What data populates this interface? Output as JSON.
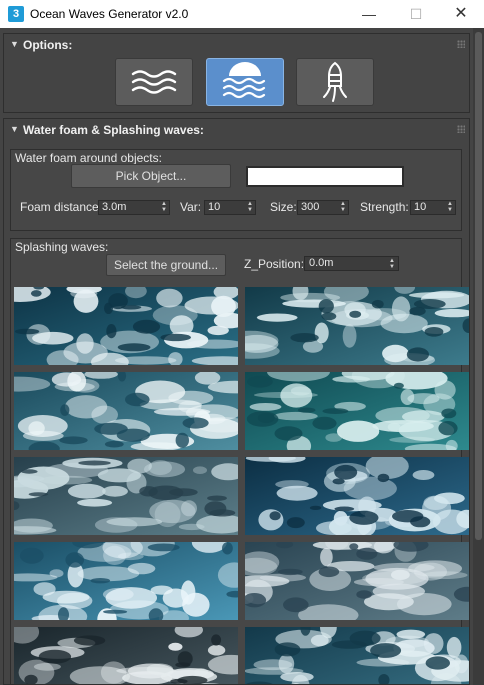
{
  "window": {
    "title": "Ocean Waves Generator v2.0",
    "app_icon": "3",
    "minimize_glyph": "—",
    "maximize_glyph": "☐",
    "close_glyph": "✕"
  },
  "options": {
    "title": "Options:",
    "buttons": [
      {
        "icon": "waves-icon",
        "active": false
      },
      {
        "icon": "sea-sunset-icon",
        "active": true
      },
      {
        "icon": "buoy-icon",
        "active": false
      }
    ]
  },
  "foam_section": {
    "title": "Water foam & Splashing waves:",
    "foam_group": {
      "title": "Water foam around objects:",
      "pick_object_label": "Pick Object...",
      "picked_object_value": "",
      "fields": [
        {
          "label": "Foam distance:",
          "value": "3.0m"
        },
        {
          "label": "Var:",
          "value": "10"
        },
        {
          "label": "Size:",
          "value": "300"
        },
        {
          "label": "Strength:",
          "value": "10"
        }
      ]
    },
    "splash_group": {
      "title": "Splashing waves:",
      "select_ground_label": "Select the ground...",
      "z_position_label": "Z_Position:",
      "z_position_value": "0.0m"
    },
    "thumbnails": [
      {
        "name": "thumbnail-1"
      },
      {
        "name": "thumbnail-2"
      },
      {
        "name": "thumbnail-3"
      },
      {
        "name": "thumbnail-4"
      },
      {
        "name": "thumbnail-5"
      },
      {
        "name": "thumbnail-6"
      },
      {
        "name": "thumbnail-7"
      },
      {
        "name": "thumbnail-8"
      },
      {
        "name": "thumbnail-9"
      },
      {
        "name": "thumbnail-10"
      }
    ]
  },
  "colors": {
    "panel_bg": "#444444",
    "accent_active": "#5b8fcc",
    "titlebar_bg": "#ffffff"
  }
}
